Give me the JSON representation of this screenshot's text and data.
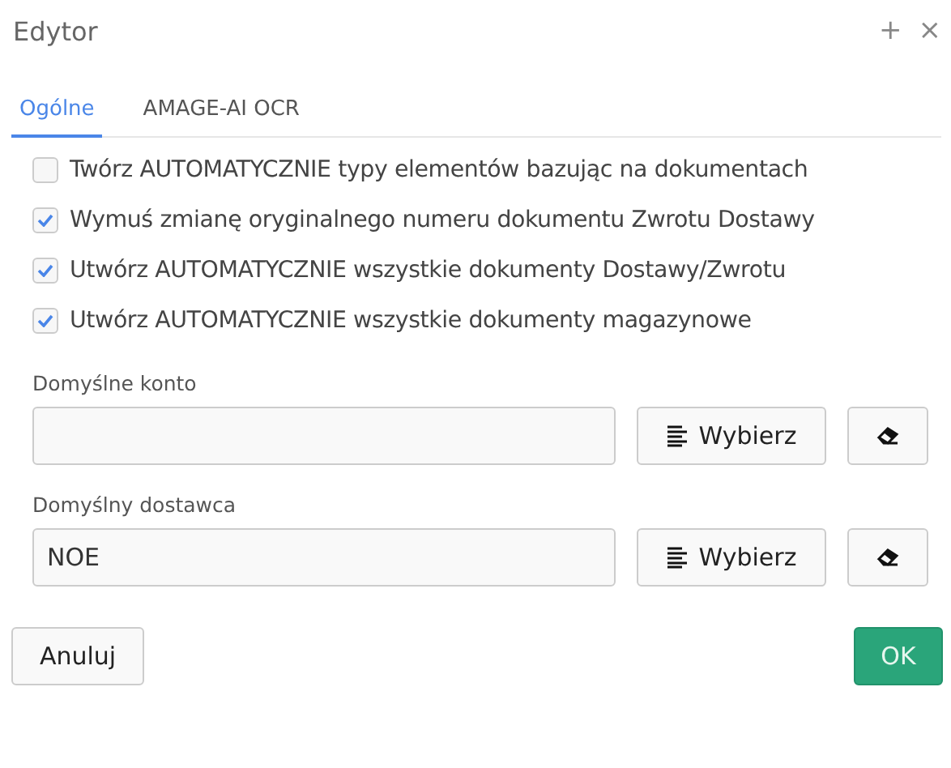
{
  "window": {
    "title": "Edytor",
    "buttons": [
      "+",
      "×"
    ]
  },
  "tabs": [
    {
      "label": "Ogólne",
      "selected": true
    },
    {
      "label": "AMAGE-AI OCR",
      "selected": false
    }
  ],
  "options": [
    {
      "label": "Twórz AUTOMATYCZNIE typy elementów bazując na dokumentach",
      "checked": false
    },
    {
      "label": "Wymuś zmianę oryginalnego numeru dokumentu Zwrotu Dostawy",
      "checked": true
    },
    {
      "label": "Utwórz AUTOMATYCZNIE wszystkie dokumenty Dostawy/Zwrotu",
      "checked": true
    },
    {
      "label": "Utwórz AUTOMATYCZNIE wszystkie dokumenty magazynowe",
      "checked": true
    }
  ],
  "fields": [
    {
      "label": "Domyślne konto",
      "button": "Wybierz"
    },
    {
      "label": "Domyślny dostawca",
      "value": "NOE",
      "button": "Wybierz"
    }
  ],
  "footer": {
    "cancel": "Anuluj",
    "ok": "OK"
  }
}
